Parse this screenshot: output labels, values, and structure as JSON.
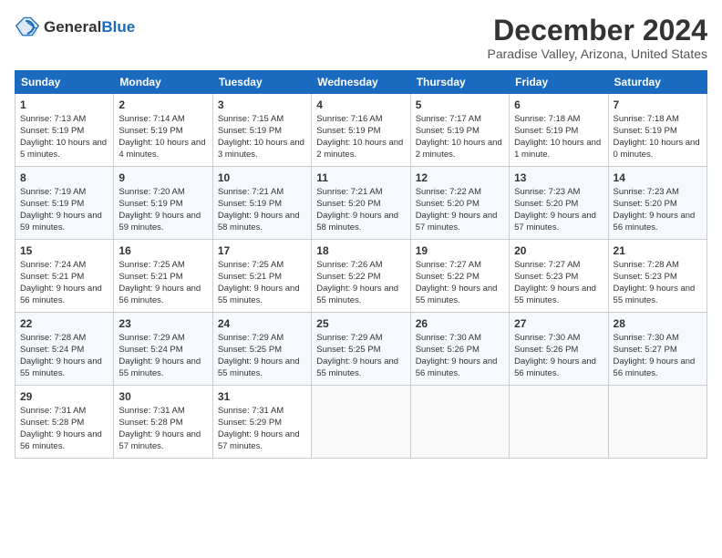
{
  "header": {
    "logo_general": "General",
    "logo_blue": "Blue",
    "month_year": "December 2024",
    "location": "Paradise Valley, Arizona, United States"
  },
  "days_of_week": [
    "Sunday",
    "Monday",
    "Tuesday",
    "Wednesday",
    "Thursday",
    "Friday",
    "Saturday"
  ],
  "weeks": [
    [
      {
        "day": "1",
        "sunrise": "7:13 AM",
        "sunset": "5:19 PM",
        "daylight": "10 hours and 5 minutes."
      },
      {
        "day": "2",
        "sunrise": "7:14 AM",
        "sunset": "5:19 PM",
        "daylight": "10 hours and 4 minutes."
      },
      {
        "day": "3",
        "sunrise": "7:15 AM",
        "sunset": "5:19 PM",
        "daylight": "10 hours and 3 minutes."
      },
      {
        "day": "4",
        "sunrise": "7:16 AM",
        "sunset": "5:19 PM",
        "daylight": "10 hours and 2 minutes."
      },
      {
        "day": "5",
        "sunrise": "7:17 AM",
        "sunset": "5:19 PM",
        "daylight": "10 hours and 2 minutes."
      },
      {
        "day": "6",
        "sunrise": "7:18 AM",
        "sunset": "5:19 PM",
        "daylight": "10 hours and 1 minute."
      },
      {
        "day": "7",
        "sunrise": "7:18 AM",
        "sunset": "5:19 PM",
        "daylight": "10 hours and 0 minutes."
      }
    ],
    [
      {
        "day": "8",
        "sunrise": "7:19 AM",
        "sunset": "5:19 PM",
        "daylight": "9 hours and 59 minutes."
      },
      {
        "day": "9",
        "sunrise": "7:20 AM",
        "sunset": "5:19 PM",
        "daylight": "9 hours and 59 minutes."
      },
      {
        "day": "10",
        "sunrise": "7:21 AM",
        "sunset": "5:19 PM",
        "daylight": "9 hours and 58 minutes."
      },
      {
        "day": "11",
        "sunrise": "7:21 AM",
        "sunset": "5:20 PM",
        "daylight": "9 hours and 58 minutes."
      },
      {
        "day": "12",
        "sunrise": "7:22 AM",
        "sunset": "5:20 PM",
        "daylight": "9 hours and 57 minutes."
      },
      {
        "day": "13",
        "sunrise": "7:23 AM",
        "sunset": "5:20 PM",
        "daylight": "9 hours and 57 minutes."
      },
      {
        "day": "14",
        "sunrise": "7:23 AM",
        "sunset": "5:20 PM",
        "daylight": "9 hours and 56 minutes."
      }
    ],
    [
      {
        "day": "15",
        "sunrise": "7:24 AM",
        "sunset": "5:21 PM",
        "daylight": "9 hours and 56 minutes."
      },
      {
        "day": "16",
        "sunrise": "7:25 AM",
        "sunset": "5:21 PM",
        "daylight": "9 hours and 56 minutes."
      },
      {
        "day": "17",
        "sunrise": "7:25 AM",
        "sunset": "5:21 PM",
        "daylight": "9 hours and 55 minutes."
      },
      {
        "day": "18",
        "sunrise": "7:26 AM",
        "sunset": "5:22 PM",
        "daylight": "9 hours and 55 minutes."
      },
      {
        "day": "19",
        "sunrise": "7:27 AM",
        "sunset": "5:22 PM",
        "daylight": "9 hours and 55 minutes."
      },
      {
        "day": "20",
        "sunrise": "7:27 AM",
        "sunset": "5:23 PM",
        "daylight": "9 hours and 55 minutes."
      },
      {
        "day": "21",
        "sunrise": "7:28 AM",
        "sunset": "5:23 PM",
        "daylight": "9 hours and 55 minutes."
      }
    ],
    [
      {
        "day": "22",
        "sunrise": "7:28 AM",
        "sunset": "5:24 PM",
        "daylight": "9 hours and 55 minutes."
      },
      {
        "day": "23",
        "sunrise": "7:29 AM",
        "sunset": "5:24 PM",
        "daylight": "9 hours and 55 minutes."
      },
      {
        "day": "24",
        "sunrise": "7:29 AM",
        "sunset": "5:25 PM",
        "daylight": "9 hours and 55 minutes."
      },
      {
        "day": "25",
        "sunrise": "7:29 AM",
        "sunset": "5:25 PM",
        "daylight": "9 hours and 55 minutes."
      },
      {
        "day": "26",
        "sunrise": "7:30 AM",
        "sunset": "5:26 PM",
        "daylight": "9 hours and 56 minutes."
      },
      {
        "day": "27",
        "sunrise": "7:30 AM",
        "sunset": "5:26 PM",
        "daylight": "9 hours and 56 minutes."
      },
      {
        "day": "28",
        "sunrise": "7:30 AM",
        "sunset": "5:27 PM",
        "daylight": "9 hours and 56 minutes."
      }
    ],
    [
      {
        "day": "29",
        "sunrise": "7:31 AM",
        "sunset": "5:28 PM",
        "daylight": "9 hours and 56 minutes."
      },
      {
        "day": "30",
        "sunrise": "7:31 AM",
        "sunset": "5:28 PM",
        "daylight": "9 hours and 57 minutes."
      },
      {
        "day": "31",
        "sunrise": "7:31 AM",
        "sunset": "5:29 PM",
        "daylight": "9 hours and 57 minutes."
      },
      null,
      null,
      null,
      null
    ]
  ],
  "labels": {
    "sunrise": "Sunrise:",
    "sunset": "Sunset:",
    "daylight": "Daylight:"
  }
}
